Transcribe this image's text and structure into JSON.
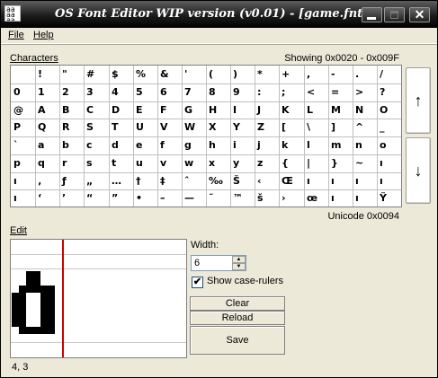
{
  "window": {
    "title": "OS Font Editor WIP version (v0.01) - [game.fnt]",
    "icon_text": "aa aa aa"
  },
  "menu": {
    "file": "File",
    "help": "Help"
  },
  "characters": {
    "label": "Characters",
    "showing": "Showing 0x0020 - 0x009F",
    "rows": [
      [
        " ",
        "!",
        "\"",
        "#",
        "$",
        "%",
        "&",
        "'",
        "(",
        ")",
        "*",
        "+",
        ",",
        "-",
        ".",
        "/"
      ],
      [
        "0",
        "1",
        "2",
        "3",
        "4",
        "5",
        "6",
        "7",
        "8",
        "9",
        ":",
        ";",
        "<",
        "=",
        ">",
        "?"
      ],
      [
        "@",
        "A",
        "B",
        "C",
        "D",
        "E",
        "F",
        "G",
        "H",
        "I",
        "J",
        "K",
        "L",
        "M",
        "N",
        "O"
      ],
      [
        "P",
        "Q",
        "R",
        "S",
        "T",
        "U",
        "V",
        "W",
        "X",
        "Y",
        "Z",
        "[",
        "\\",
        "]",
        "^",
        "_"
      ],
      [
        "`",
        "a",
        "b",
        "c",
        "d",
        "e",
        "f",
        "g",
        "h",
        "i",
        "j",
        "k",
        "l",
        "m",
        "n",
        "o"
      ],
      [
        "p",
        "q",
        "r",
        "s",
        "t",
        "u",
        "v",
        "w",
        "x",
        "y",
        "z",
        "{",
        "|",
        "}",
        "~",
        "ı"
      ],
      [
        "ı",
        "‚",
        "ƒ",
        "„",
        "…",
        "†",
        "‡",
        "ˆ",
        "‰",
        "Š",
        "‹",
        "Œ",
        "ı",
        "ı",
        "ı",
        "ı"
      ],
      [
        "ı",
        "‘",
        "’",
        "“",
        "”",
        "•",
        "–",
        "—",
        "˜",
        "™",
        "š",
        "›",
        "œ",
        "ı",
        "ı",
        "Ÿ"
      ]
    ],
    "unicode_readout": "Unicode 0x0094"
  },
  "edit": {
    "label": "Edit",
    "width_label": "Width:",
    "width_value": "6",
    "show_rulers_label": "Show case-rulers",
    "show_rulers_checked": true,
    "check_glyph": "✔",
    "clear": "Clear",
    "reload": "Reload",
    "save": "Save"
  },
  "scroll": {
    "up_glyph": "↑",
    "down_glyph": "↓"
  },
  "status": {
    "position": "4, 3"
  }
}
